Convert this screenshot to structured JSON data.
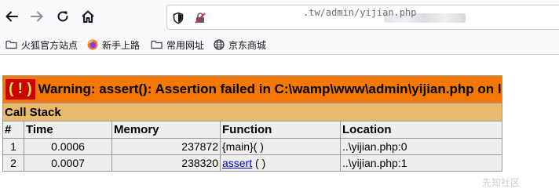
{
  "browser": {
    "url_path": ".tw/admin/yijian.php"
  },
  "bookmarks": [
    {
      "label": "火狐官方站点",
      "icon": "folder-icon"
    },
    {
      "label": "新手上路",
      "icon": "firefox-icon"
    },
    {
      "label": "常用网址",
      "icon": "folder-icon"
    },
    {
      "label": "京东商城",
      "icon": "globe-icon"
    }
  ],
  "error": {
    "badge": "( ! )",
    "message": "Warning: assert(): Assertion failed in C:\\wamp\\www\\admin\\yijian.php on line ",
    "line": "1",
    "call_stack_title": "Call Stack",
    "columns": [
      "#",
      "Time",
      "Memory",
      "Function",
      "Location"
    ],
    "rows": [
      {
        "num": "1",
        "time": "0.0006",
        "memory": "237872",
        "function": "{main}( )",
        "location": "..\\yijian.php:0"
      },
      {
        "num": "2",
        "time": "0.0007",
        "memory": "238320",
        "function_link": "assert",
        "function_suffix": " ( )",
        "location": "..\\yijian.php:1"
      }
    ]
  },
  "colors": {
    "warning_bg": "#f57900",
    "badge_bg": "#cc0000",
    "badge_text": "#fce94f",
    "stack_bg": "#e9b96e",
    "cell_bg": "#eeeeec",
    "link": "#0000cc"
  },
  "watermark": "先知社区"
}
